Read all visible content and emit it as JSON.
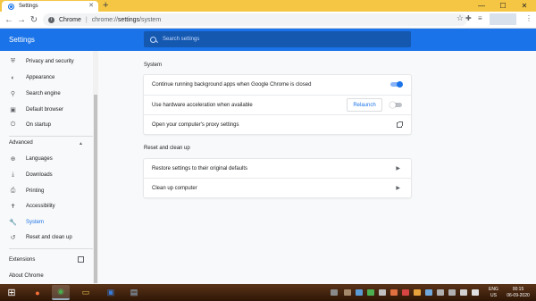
{
  "window": {
    "tab_title": "Settings",
    "new_tab": "+",
    "minimize": "—",
    "maximize": "☐",
    "close": "✕"
  },
  "toolbar": {
    "origin": "Chrome",
    "url_scheme": "chrome://",
    "url_host": "settings",
    "url_path": "/system"
  },
  "header": {
    "title": "Settings",
    "search_placeholder": "Search settings"
  },
  "sidebar": {
    "items": [
      {
        "label": "Privacy and security",
        "icon": "shield-icon",
        "glyph": "⛨"
      },
      {
        "label": "Appearance",
        "icon": "palette-icon",
        "glyph": "◐"
      },
      {
        "label": "Search engine",
        "icon": "search-icon",
        "glyph": "⚲"
      },
      {
        "label": "Default browser",
        "icon": "browser-icon",
        "glyph": "▣"
      },
      {
        "label": "On startup",
        "icon": "power-icon",
        "glyph": "⏻"
      }
    ],
    "advanced_label": "Advanced",
    "advanced_items": [
      {
        "label": "Languages",
        "icon": "globe-icon",
        "glyph": "⊕"
      },
      {
        "label": "Downloads",
        "icon": "download-icon",
        "glyph": "⤓"
      },
      {
        "label": "Printing",
        "icon": "printer-icon",
        "glyph": "⎙"
      },
      {
        "label": "Accessibility",
        "icon": "accessibility-icon",
        "glyph": "✝"
      },
      {
        "label": "System",
        "icon": "wrench-icon",
        "glyph": "🔧",
        "active": true
      },
      {
        "label": "Reset and clean up",
        "icon": "history-icon",
        "glyph": "↺"
      }
    ],
    "extensions_label": "Extensions",
    "about_label": "About Chrome"
  },
  "system": {
    "title": "System",
    "rows": [
      {
        "label": "Continue running background apps when Google Chrome is closed",
        "toggle": true
      },
      {
        "label": "Use hardware acceleration when available",
        "toggle": false,
        "button": "Relaunch"
      },
      {
        "label": "Open your computer's proxy settings"
      }
    ]
  },
  "reset": {
    "title": "Reset and clean up",
    "rows": [
      {
        "label": "Restore settings to their original defaults"
      },
      {
        "label": "Clean up computer"
      }
    ]
  },
  "taskbar": {
    "lang_top": "ENG",
    "lang_bottom": "US",
    "time": "00:15",
    "date": "06-09-2020"
  },
  "colors": {
    "accent": "#1a73e8",
    "tab_strip": "#f5c644",
    "taskbar": "#3a1f0c"
  }
}
